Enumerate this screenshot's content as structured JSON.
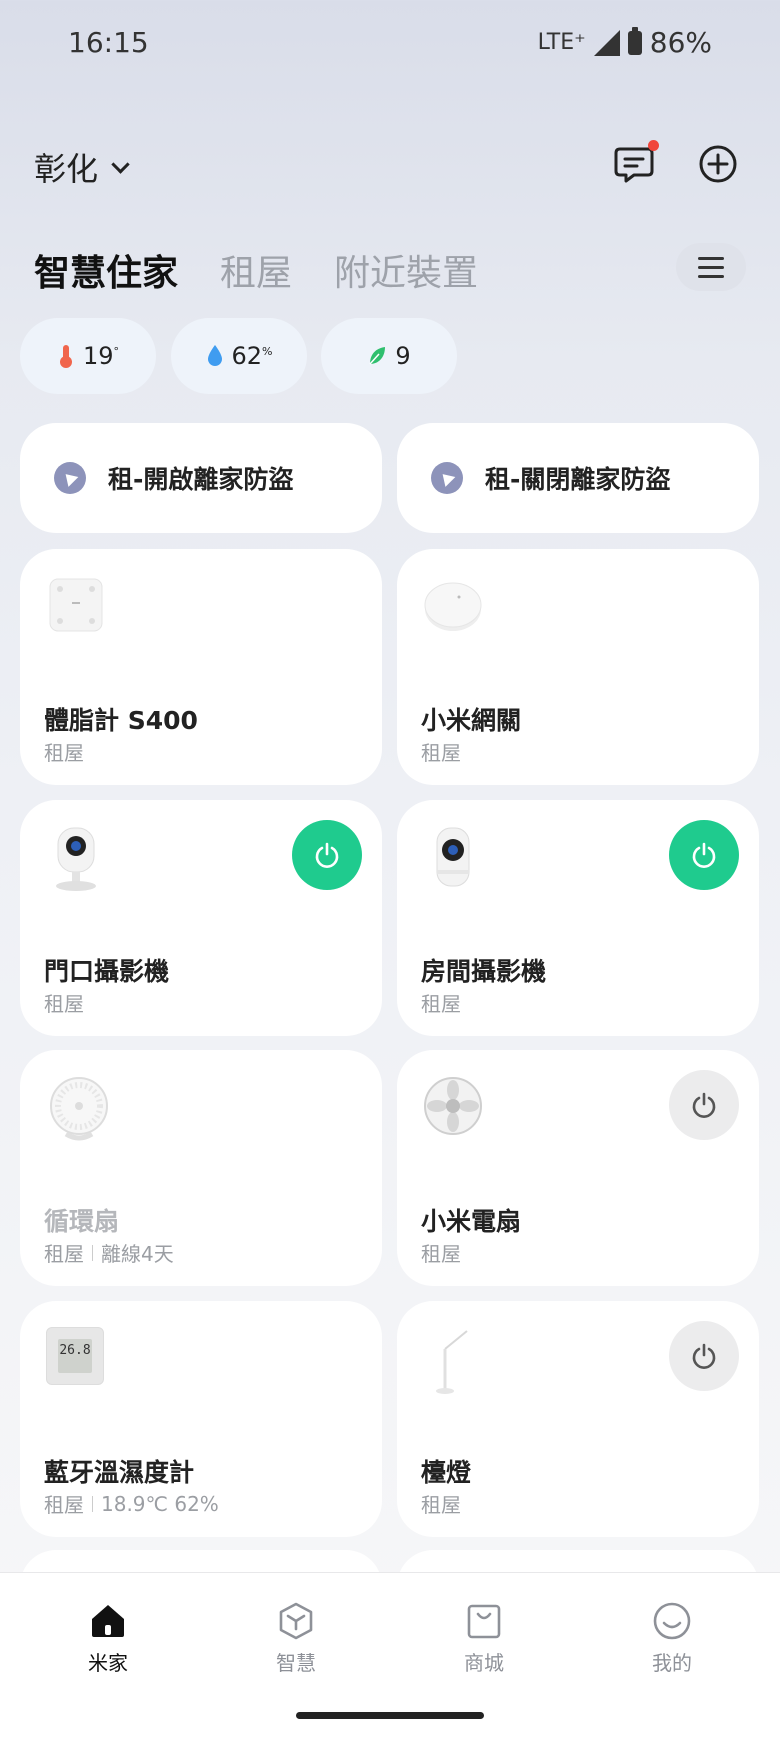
{
  "status": {
    "time": "16:15",
    "network": "LTE⁺",
    "battery": "86%"
  },
  "header": {
    "location": "彰化"
  },
  "tabs": [
    "智慧住家",
    "租屋",
    "附近裝置"
  ],
  "env": {
    "temperature": "19",
    "temp_unit": "°",
    "humidity": "62",
    "humidity_unit": "%",
    "air": "9"
  },
  "scenes": [
    "租-開啟離家防盜",
    "租-關閉離家防盜"
  ],
  "devices": [
    {
      "name": "體脂計 S400",
      "room": "租屋"
    },
    {
      "name": "小米網關",
      "room": "租屋"
    },
    {
      "name": "門口攝影機",
      "room": "租屋",
      "power": "on"
    },
    {
      "name": "房間攝影機",
      "room": "租屋",
      "power": "on"
    },
    {
      "name": "循環扇",
      "room": "租屋",
      "status": "離線4天"
    },
    {
      "name": "小米電扇",
      "room": "租屋",
      "power": "off"
    },
    {
      "name": "藍牙溫濕度計",
      "room": "租屋",
      "status": "18.9℃ 62%",
      "display": "26.8"
    },
    {
      "name": "檯燈",
      "room": "租屋",
      "power": "off"
    }
  ],
  "nav": [
    "米家",
    "智慧",
    "商城",
    "我的"
  ],
  "colors": {
    "power_on": "#1fcb8e",
    "power_off": "#ececed",
    "badge": "#f0453b"
  }
}
